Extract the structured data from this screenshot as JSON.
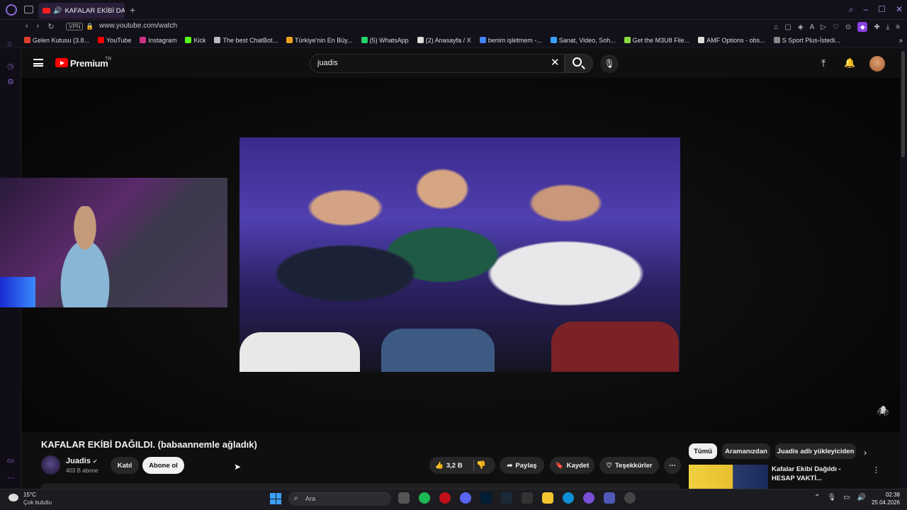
{
  "browser": {
    "tab_title": "KAFALAR EKİBİ DAĞILD",
    "url": "www.youtube.com/watch",
    "vpn": "VPN",
    "bookmarks": [
      {
        "label": "Gelen Kutusu (3.8...",
        "color": "#e04030"
      },
      {
        "label": "YouTube",
        "color": "#ff0000"
      },
      {
        "label": "Instagram",
        "color": "#d0308a"
      },
      {
        "label": "Kick",
        "color": "#53fc18"
      },
      {
        "label": "The best ChatBot...",
        "color": "#bbbbbb"
      },
      {
        "label": "Türkiye'nin En Büy...",
        "color": "#f0a020"
      },
      {
        "label": "(5) WhatsApp",
        "color": "#25d366"
      },
      {
        "label": "(2) Anasayfa / X",
        "color": "#dddddd"
      },
      {
        "label": "benim işletmem -...",
        "color": "#4285f4"
      },
      {
        "label": "Sanat, Video, Soh...",
        "color": "#3aa0ff"
      },
      {
        "label": "Get the M3U8 File...",
        "color": "#8bd940"
      },
      {
        "label": "AMF Options - obs...",
        "color": "#dddddd"
      },
      {
        "label": "S Sport Plus-İstedi...",
        "color": "#888888"
      }
    ]
  },
  "youtube": {
    "brand": "Premium",
    "country": "TR",
    "search_value": "juadis",
    "video_title": "KAFALAR EKİBİ DAĞILDI. (babaannemle ağladık)",
    "channel": {
      "name": "Juadis",
      "subs": "403 B abone"
    },
    "join_label": "Katıl",
    "subscribe_label": "Abone ol",
    "like_count": "3,2 B",
    "share_label": "Paylaş",
    "save_label": "Kaydet",
    "thanks_label": "Teşekkürler",
    "chips": [
      "Tümü",
      "Aramanızdan",
      "Juadis adlı yükleyiciden"
    ],
    "related_title": "Kafalar Ekibi Dağıldı - HESAP VAKTİ..."
  },
  "taskbar": {
    "temp": "15°C",
    "condition": "Çok bulutlu",
    "search_placeholder": "Ara",
    "time": "02:38",
    "date": "25.04.2026"
  }
}
